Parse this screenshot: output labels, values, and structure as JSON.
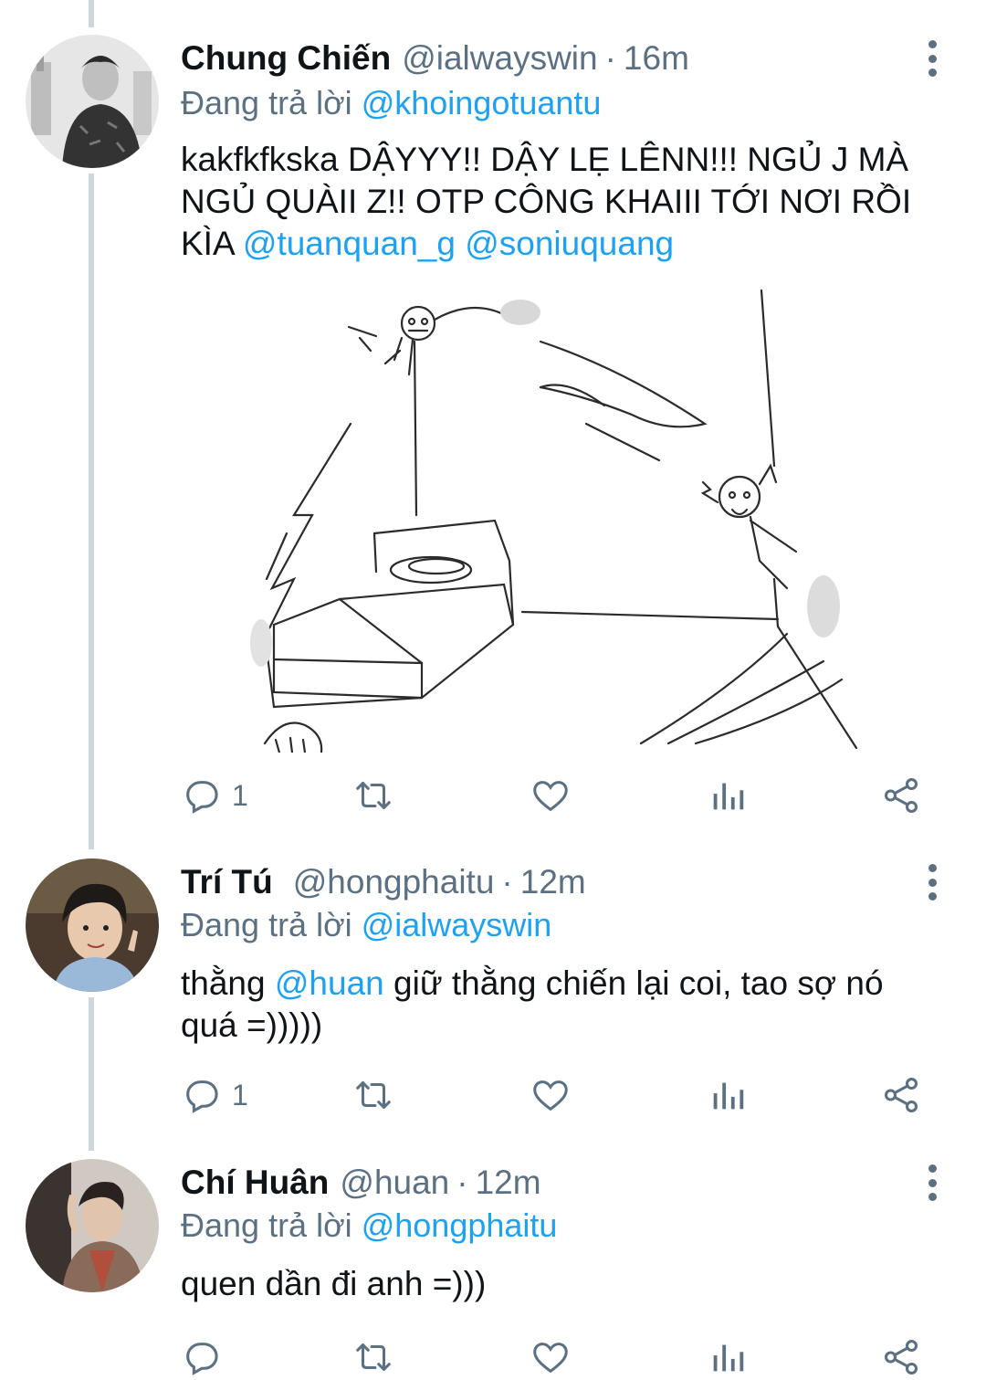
{
  "colors": {
    "accent": "#1da1f2",
    "secondary_text": "#5b7083",
    "thread_line": "#ccd6dd"
  },
  "tweets": [
    {
      "name": "Chung Chiến",
      "handle": "@ialwayswin",
      "separator": "·",
      "time": "16m",
      "reply_prefix": "Đang trả lời",
      "reply_to": "@khoingotuantu",
      "text_parts": [
        "kakfkfkska DẬYYY!! DẬY LẸ LÊNN!!! NGỦ J MÀ NGỦ QUÀII Z!! OTP CÔNG KHAIII TỚI NƠI RỒI KÌA ",
        "@tuanquan_g",
        " ",
        "@soniuquang"
      ],
      "reply_count": "1",
      "media_icon": "sketch-drawing"
    },
    {
      "name": "Trí Tú",
      "handle": "@hongphaitu",
      "separator": "·",
      "time": "12m",
      "reply_prefix": "Đang trả lời",
      "reply_to": "@ialwayswin",
      "text_parts": [
        "thằng ",
        "@huan",
        " giữ thằng chiến lại coi, tao sợ nó quá =)))))"
      ],
      "reply_count": "1"
    },
    {
      "name": "Chí Huân",
      "handle": "@huan",
      "separator": "·",
      "time": "12m",
      "reply_prefix": "Đang trả lời",
      "reply_to": "@hongphaitu",
      "text_parts": [
        "quen dần đi anh =)))"
      ],
      "reply_count": ""
    }
  ],
  "icons": [
    "reply-icon",
    "retweet-icon",
    "like-icon",
    "analytics-icon",
    "share-icon",
    "more-options-icon"
  ]
}
